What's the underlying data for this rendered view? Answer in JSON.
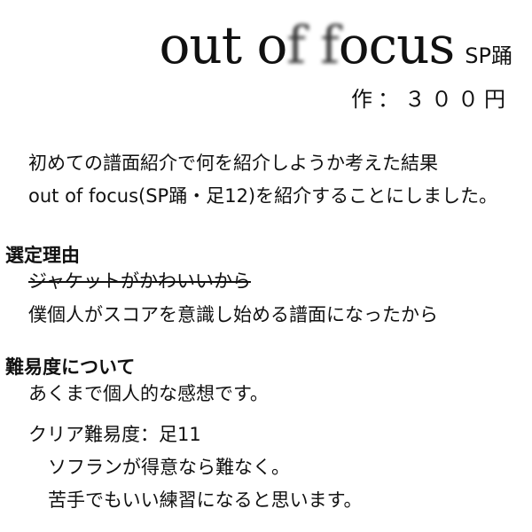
{
  "header": {
    "title_parts": [
      "out o",
      "f",
      " ",
      "f",
      "ocus"
    ],
    "chart_tag": "SP踊",
    "credit": "作：３００円"
  },
  "intro": {
    "line1": "初めての譜面紹介で何を紹介しようか考えた結果",
    "line2": "out of focus(SP踊・足12)を紹介することにしました。"
  },
  "reason": {
    "heading": "選定理由",
    "struck": "ジャケットがかわいいから",
    "text": "僕個人がスコアを意識し始める譜面になったから"
  },
  "difficulty": {
    "heading": "難易度について",
    "note": "あくまで個人的な感想です。",
    "clear_label": "クリア難易度：足11",
    "detail1": "ソフランが得意なら難なく。",
    "detail2": "苦手でもいい練習になると思います。"
  }
}
